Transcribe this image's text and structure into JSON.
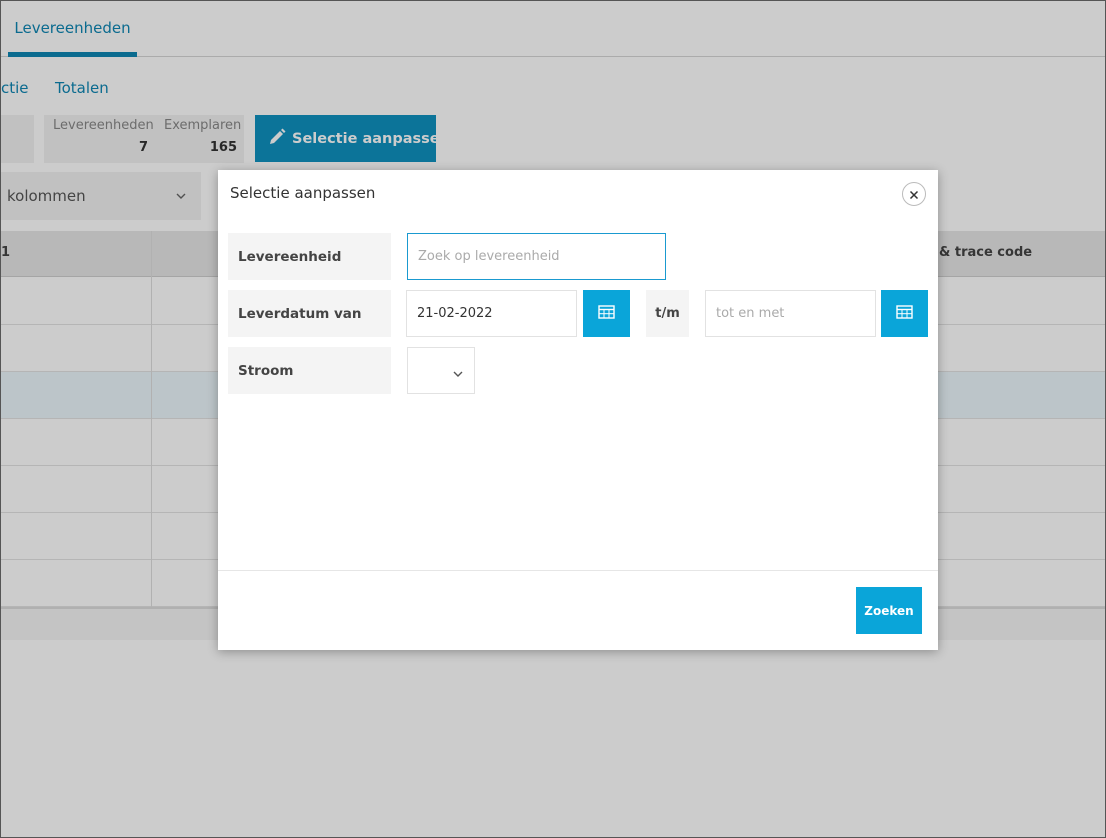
{
  "app": {
    "top_tab": "Levereenheden",
    "subnav": [
      "ctie",
      "Totalen"
    ],
    "stats": {
      "levereenheden_label": "Levereenheden",
      "levereenheden_value": "7",
      "exemplaren_label": "Exemplaren",
      "exemplaren_value": "165"
    },
    "edit_selection_button": "Selectie aanpassen",
    "columns_select": "kolommen",
    "grid": {
      "header_left": "1",
      "header_right": "& trace code"
    }
  },
  "modal": {
    "title": "Selectie aanpassen",
    "fields": {
      "levereenheid_label": "Levereenheid",
      "levereenheid_placeholder": "Zoek op levereenheid",
      "leverdatum_label": "Leverdatum van",
      "leverdatum_from_value": "21-02-2022",
      "tm_label": "t/m",
      "leverdatum_to_placeholder": "tot en met",
      "stroom_label": "Stroom"
    },
    "search_button": "Zoeken"
  },
  "colors": {
    "accent": "#0aa5d9",
    "tab_accent": "#0e86b3"
  },
  "icons": [
    "pencil-icon",
    "chevron-down-icon",
    "calendar-icon",
    "close-icon"
  ]
}
